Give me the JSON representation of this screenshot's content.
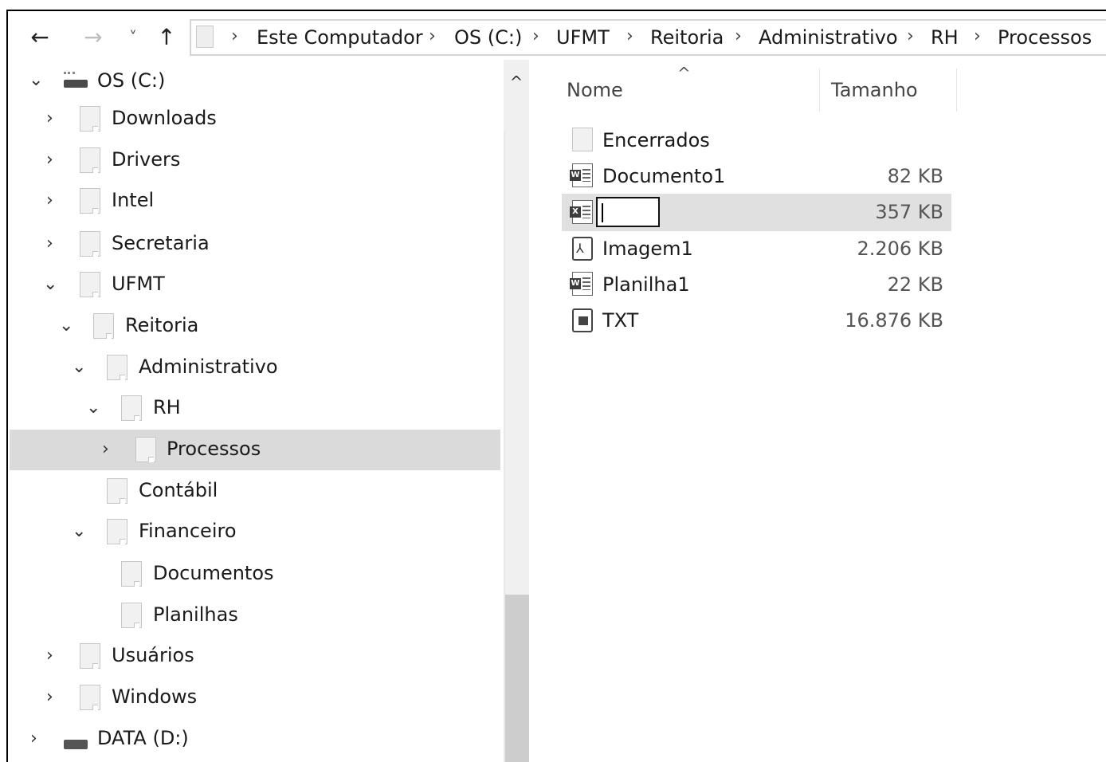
{
  "nav": {
    "back": "←",
    "forward": "→",
    "recent": "˅",
    "up": "↑"
  },
  "breadcrumb": [
    "Este Computador",
    "OS (C:)",
    "UFMT",
    "Reitoria",
    "Administrativo",
    "RH",
    "Processos"
  ],
  "breadcrumb_sep": "›",
  "tree": {
    "items": [
      {
        "label": "OS (C:)",
        "chevron": "⌄",
        "icon": "drive-c-icon"
      },
      {
        "label": "Downloads",
        "chevron": "›",
        "icon": "folder-icon"
      },
      {
        "label": "Drivers",
        "chevron": "›",
        "icon": "folder-icon"
      },
      {
        "label": "Intel",
        "chevron": "›",
        "icon": "folder-icon"
      },
      {
        "label": "Secretaria",
        "chevron": "›",
        "icon": "folder-icon"
      },
      {
        "label": "UFMT",
        "chevron": "⌄",
        "icon": "folder-icon"
      },
      {
        "label": "Reitoria",
        "chevron": "⌄",
        "icon": "folder-icon"
      },
      {
        "label": "Administrativo",
        "chevron": "⌄",
        "icon": "folder-icon"
      },
      {
        "label": "RH",
        "chevron": "⌄",
        "icon": "folder-icon"
      },
      {
        "label": "Processos",
        "chevron": "›",
        "icon": "folder-icon",
        "selected": true
      },
      {
        "label": "Contábil",
        "chevron": "",
        "icon": "folder-icon"
      },
      {
        "label": "Financeiro",
        "chevron": "⌄",
        "icon": "folder-icon"
      },
      {
        "label": "Documentos",
        "chevron": "",
        "icon": "folder-icon"
      },
      {
        "label": "Planilhas",
        "chevron": "",
        "icon": "folder-icon"
      },
      {
        "label": "Usuários",
        "chevron": "›",
        "icon": "folder-icon"
      },
      {
        "label": "Windows",
        "chevron": "›",
        "icon": "folder-icon"
      },
      {
        "label": "DATA (D:)",
        "chevron": "›",
        "icon": "drive-icon"
      }
    ]
  },
  "scrollbar": {
    "up_arrow": "^"
  },
  "columns": {
    "name": "Nome",
    "size": "Tamanho",
    "sort_indicator": "^"
  },
  "files": [
    {
      "name": "Encerrados",
      "size": "",
      "icon": "folder-icon"
    },
    {
      "name": "Documento1",
      "size": "82 KB",
      "icon": "word-doc-icon"
    },
    {
      "name": "",
      "size": "357 KB",
      "icon": "excel-doc-icon",
      "renaming": true
    },
    {
      "name": "Imagem1",
      "size": "2.206 KB",
      "icon": "pdf-doc-icon"
    },
    {
      "name": "Planilha1",
      "size": "22 KB",
      "icon": "word-doc-icon"
    },
    {
      "name": "TXT",
      "size": "16.876 KB",
      "icon": "txt-doc-icon"
    }
  ],
  "badges": {
    "word": "W",
    "excel": "X",
    "pdf": "⅄"
  }
}
